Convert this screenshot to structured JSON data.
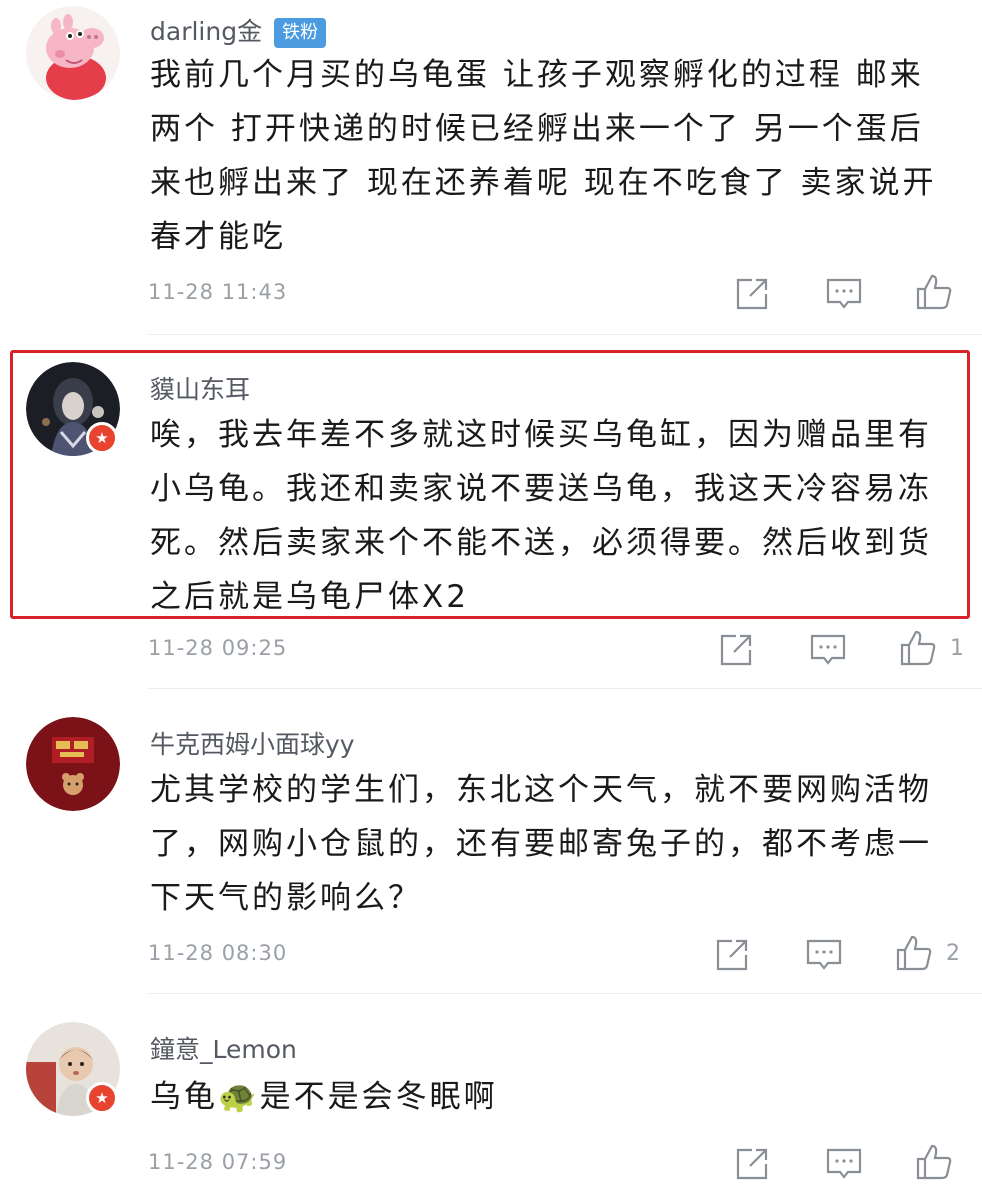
{
  "comments": [
    {
      "username": "darling金",
      "fan_badge": "铁粉",
      "text": "我前几个月买的乌龟蛋 让孩子观察孵化的过程 邮来两个 打开快递的时候已经孵出来一个了 另一个蛋后来也孵出来了 现在还养着呢 现在不吃食了 卖家说开春才能吃",
      "time": "11-28 11:43",
      "likes": ""
    },
    {
      "username": "貘山东耳",
      "text": "唉，我去年差不多就这时候买乌龟缸，因为赠品里有小乌龟。我还和卖家说不要送乌龟，我这天冷容易冻死。然后卖家来个不能不送，必须得要。然后收到货之后就是乌龟尸体X2",
      "time": "11-28 09:25",
      "likes": "1"
    },
    {
      "username": "牛克西姆小面球yy",
      "text": "尤其学校的学生们，东北这个天气，就不要网购活物了，网购小仓鼠的，还有要邮寄兔子的，都不考虑一下天气的影响么？",
      "time": "11-28 08:30",
      "likes": "2"
    },
    {
      "username": "鐘意_Lemon",
      "text": "乌龟🐢是不是会冬眠啊",
      "time": "11-28 07:59",
      "likes": ""
    }
  ],
  "icons": {
    "share": "share-icon",
    "reply": "comment-icon",
    "like": "thumbs-up-icon",
    "verified": "star-badge-icon"
  },
  "colors": {
    "highlight": "#d8232a",
    "fan_badge": "#4a9be0",
    "verified_badge": "#e8432f"
  }
}
